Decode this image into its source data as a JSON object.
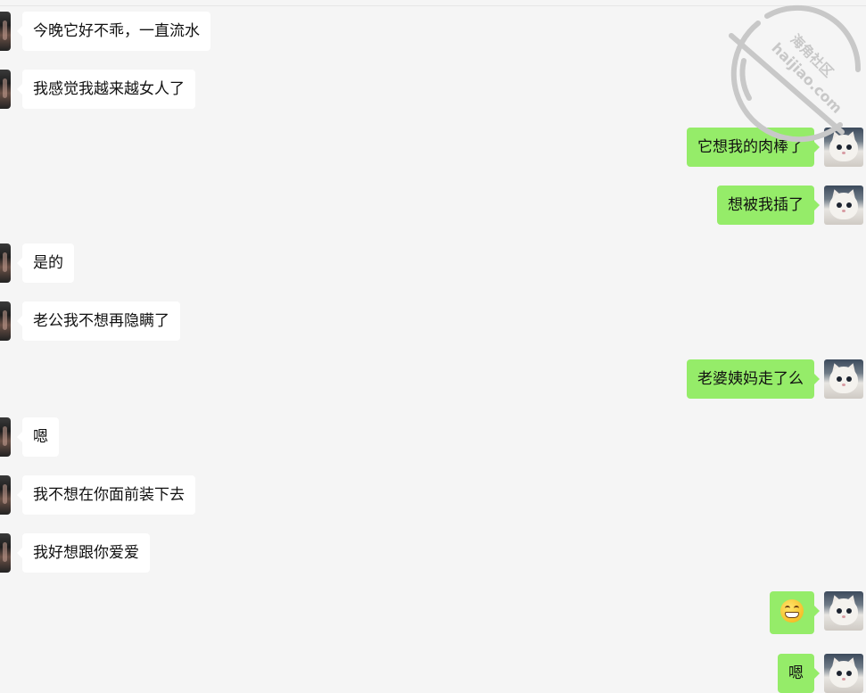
{
  "messages": [
    {
      "side": "in",
      "text": "今晚它好不乖，一直流水"
    },
    {
      "side": "in",
      "text": "我感觉我越来越女人了"
    },
    {
      "side": "out",
      "text": "它想我的肉棒了"
    },
    {
      "side": "out",
      "text": "想被我插了"
    },
    {
      "side": "in",
      "text": "是的"
    },
    {
      "side": "in",
      "text": "老公我不想再隐瞒了"
    },
    {
      "side": "out",
      "text": "老婆姨妈走了么"
    },
    {
      "side": "in",
      "text": "嗯"
    },
    {
      "side": "in",
      "text": "我不想在你面前装下去"
    },
    {
      "side": "in",
      "text": "我好想跟你爱爱"
    },
    {
      "side": "out",
      "text": "",
      "emoji": "grinning-face-emoji"
    },
    {
      "side": "out",
      "text": "嗯"
    }
  ],
  "watermark": {
    "cn": "海角社区",
    "en": "haijiao.com"
  },
  "colors": {
    "background": "#f5f5f5",
    "incoming_bubble": "#ffffff",
    "outgoing_bubble": "#95ec69",
    "text": "#111111",
    "watermark": "#c8c8c8"
  },
  "icons": {
    "incoming_avatar": "contact-avatar",
    "outgoing_avatar": "white-cat-avatar",
    "watermark": "no-entry-sign-icon"
  }
}
